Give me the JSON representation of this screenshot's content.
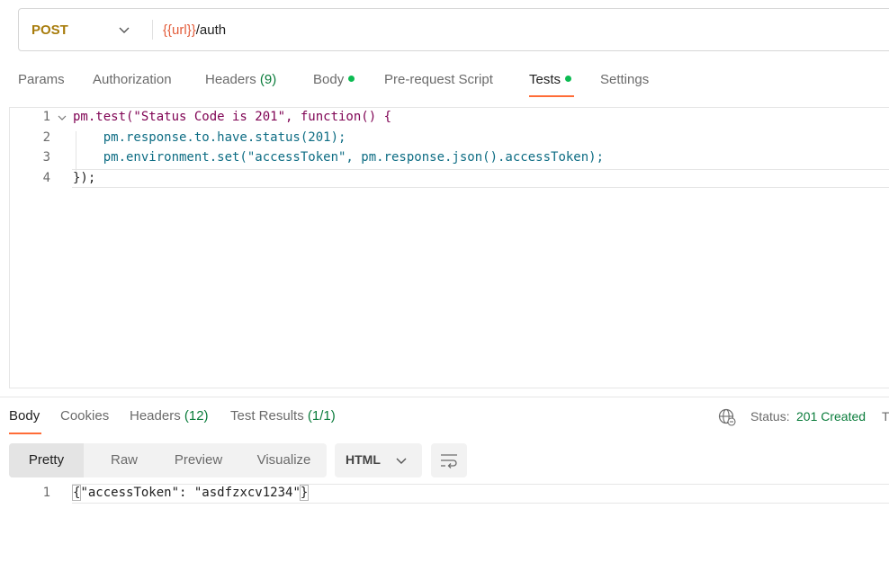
{
  "request": {
    "method": "POST",
    "url_variable": "{{url}}",
    "url_path": "/auth"
  },
  "request_tabs": {
    "params": "Params",
    "authorization": "Authorization",
    "headers": "Headers",
    "headers_count": "(9)",
    "body": "Body",
    "prerequest": "Pre-request Script",
    "tests": "Tests",
    "settings": "Settings",
    "active": "Tests"
  },
  "editor": {
    "line_numbers": [
      "1",
      "2",
      "3",
      "4"
    ],
    "lines": [
      "pm.test(\"Status Code is 201\", function() {",
      "    pm.response.to.have.status(201);",
      "    pm.environment.set(\"accessToken\", pm.response.json().accessToken);",
      "});"
    ]
  },
  "response_tabs": {
    "body": "Body",
    "cookies": "Cookies",
    "headers": "Headers",
    "headers_count": "(12)",
    "test_results": "Test Results",
    "test_results_count": "(1/1)",
    "active": "Body"
  },
  "status": {
    "label": "Status:",
    "value": "201 Created",
    "truncated_next": "T"
  },
  "view_modes": {
    "pretty": "Pretty",
    "raw": "Raw",
    "preview": "Preview",
    "visualize": "Visualize",
    "active": "Pretty"
  },
  "format": {
    "selected": "HTML"
  },
  "response_body": {
    "line_numbers": [
      "1"
    ],
    "open_brace": "{",
    "content": "\"accessToken\": \"asdfzxcv1234\"",
    "close_brace": "}"
  },
  "colors": {
    "accent_underline": "#ff6c37",
    "method_post": "#a87c0c",
    "success_green": "#0a7c3b",
    "dot_green": "#0cbb52",
    "url_variable": "#e35d3b"
  }
}
